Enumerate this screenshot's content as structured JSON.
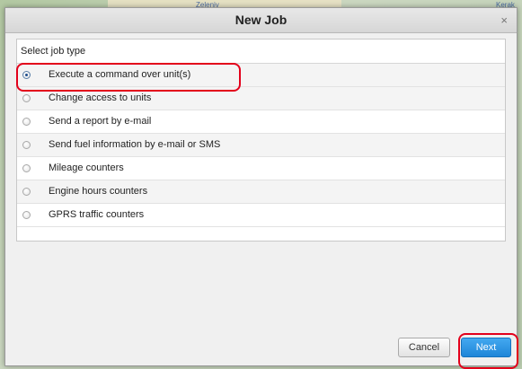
{
  "background": {
    "map_labels": [
      "Zeleniv",
      "Kerak"
    ]
  },
  "dialog": {
    "title": "New Job",
    "close_symbol": "×",
    "panel_header": "Select job type",
    "options": [
      {
        "label": "Execute a command over unit(s)",
        "selected": true
      },
      {
        "label": "Change access to units",
        "selected": false
      },
      {
        "label": "Send a report by e-mail",
        "selected": false
      },
      {
        "label": "Send fuel information by e-mail or SMS",
        "selected": false
      },
      {
        "label": "Mileage counters",
        "selected": false
      },
      {
        "label": "Engine hours counters",
        "selected": false
      },
      {
        "label": "GPRS traffic counters",
        "selected": false
      }
    ],
    "buttons": {
      "cancel": "Cancel",
      "next": "Next"
    }
  },
  "colors": {
    "accent": "#2b92e4",
    "annotation": "#e3001b"
  }
}
